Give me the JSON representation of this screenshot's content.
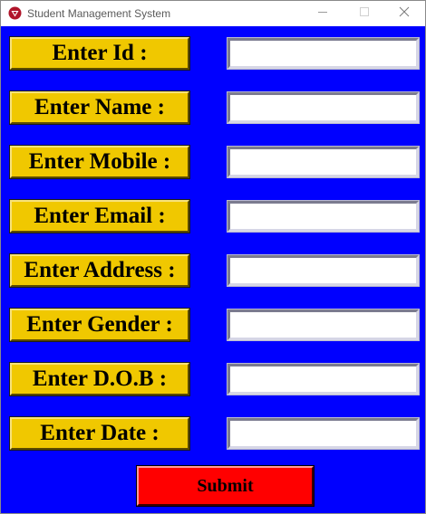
{
  "window": {
    "title": "Student Management System",
    "icon": "app-logo-icon",
    "controls": {
      "minimize_icon": "minimize-icon",
      "maximize_icon": "maximize-icon",
      "close_icon": "close-icon"
    }
  },
  "form": {
    "fields": [
      {
        "label": "Enter Id :",
        "value": ""
      },
      {
        "label": "Enter Name :",
        "value": ""
      },
      {
        "label": "Enter Mobile :",
        "value": ""
      },
      {
        "label": "Enter Email :",
        "value": ""
      },
      {
        "label": "Enter Address :",
        "value": ""
      },
      {
        "label": "Enter Gender :",
        "value": ""
      },
      {
        "label": "Enter D.O.B :",
        "value": ""
      },
      {
        "label": "Enter Date :",
        "value": ""
      }
    ],
    "submit_label": "Submit"
  },
  "colors": {
    "background": "#0000ff",
    "label_bg": "#f0c800",
    "submit_bg": "#ff0000",
    "entry_bg": "#ffffff"
  }
}
